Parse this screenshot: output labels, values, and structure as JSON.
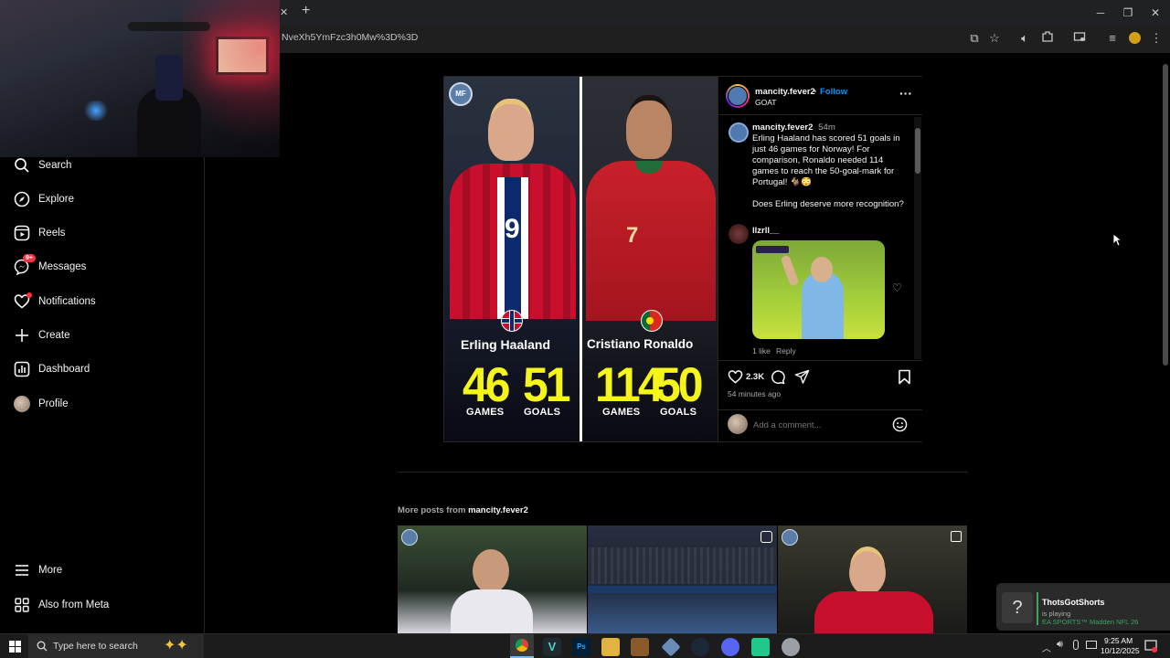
{
  "browser": {
    "url_fragment": "NveXh5YmFzc3h0Mw%3D%3D",
    "new_tab_symbol": "+",
    "close_tab_symbol": "✕"
  },
  "sidebar": {
    "items": [
      {
        "label": "Search",
        "icon": "search-icon"
      },
      {
        "label": "Explore",
        "icon": "compass-icon"
      },
      {
        "label": "Reels",
        "icon": "reels-icon"
      },
      {
        "label": "Messages",
        "icon": "messenger-icon",
        "badge": "9+"
      },
      {
        "label": "Notifications",
        "icon": "heart-icon"
      },
      {
        "label": "Create",
        "icon": "plus-icon"
      },
      {
        "label": "Dashboard",
        "icon": "dashboard-icon"
      },
      {
        "label": "Profile",
        "icon": "avatar"
      }
    ],
    "more_label": "More",
    "meta_label": "Also from Meta"
  },
  "post": {
    "graphic": {
      "player1_name": "Erling Haaland",
      "player1_games": "46",
      "player1_goals": "51",
      "player2_name": "Cristiano Ronaldo",
      "player2_games": "114",
      "player2_goals": "50",
      "games_label": "GAMES",
      "goals_label": "GOALS",
      "shirt_number_left": "9",
      "shirt_number_right": "7"
    },
    "header": {
      "username": "mancity.fever2",
      "separator": "•",
      "follow": "Follow",
      "subtitle": "GOAT",
      "more": "···"
    },
    "caption": {
      "username": "mancity.fever2",
      "time": "54m",
      "text": "Erling Haaland has scored 51 goals in just 46 games for Norway! For comparison, Ronaldo needed 114 games to reach the 50-goal-mark for Portugal! 🐐😳",
      "question": "Does Erling deserve more recognition?"
    },
    "comment": {
      "username": "llzrll__",
      "likes": "1 like",
      "reply": "Reply"
    },
    "actions": {
      "like_count": "2.3K",
      "timestamp": "54 minutes ago",
      "comment_placeholder": "Add a comment..."
    }
  },
  "more_posts": {
    "prefix": "More posts from ",
    "username": "mancity.fever2"
  },
  "stream_overlay": {
    "streamer": "ThotsGotShorts",
    "status": "is playing",
    "game": "EA SPORTS™ Madden NFL 26"
  },
  "taskbar": {
    "search_placeholder": "Type here to search",
    "time": "9:25 AM",
    "date": "10/12/2025"
  },
  "colors": {
    "accent_follow": "#0095f6",
    "stat_yellow": "#f5f51c",
    "norway_red": "#c8102e",
    "portugal_red": "#c8202a"
  }
}
